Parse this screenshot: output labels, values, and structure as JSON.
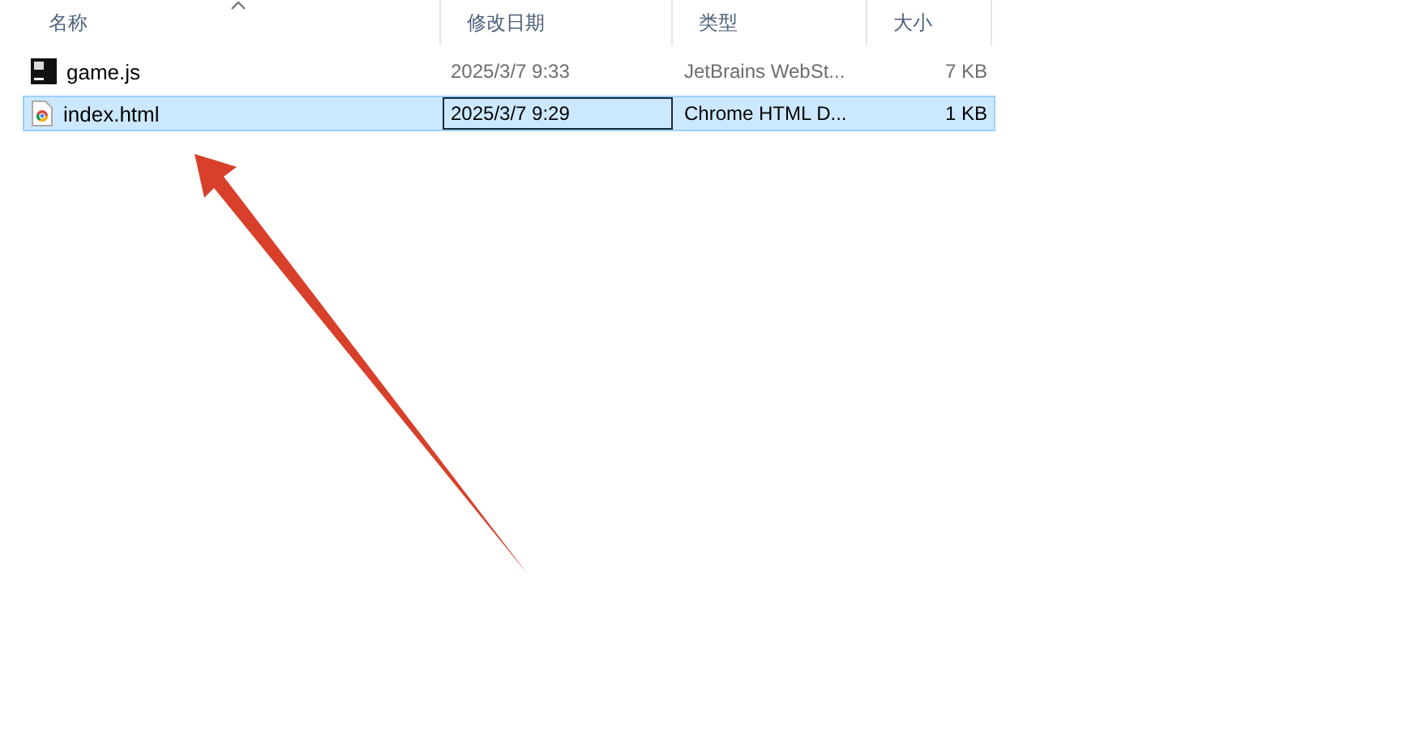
{
  "columns": [
    {
      "label": "名称",
      "sorted": true
    },
    {
      "label": "修改日期",
      "sorted": false
    },
    {
      "label": "类型",
      "sorted": false
    },
    {
      "label": "大小",
      "sorted": false
    }
  ],
  "files": [
    {
      "kind": "script",
      "name": "game.js",
      "modified": "2025/3/7 9:33",
      "type": "JetBrains WebSt...",
      "size": "7 KB",
      "selected": false
    },
    {
      "kind": "html",
      "name": "index.html",
      "modified": "2025/3/7 9:29",
      "type": "Chrome HTML D...",
      "size": "1 KB",
      "selected": true
    }
  ]
}
